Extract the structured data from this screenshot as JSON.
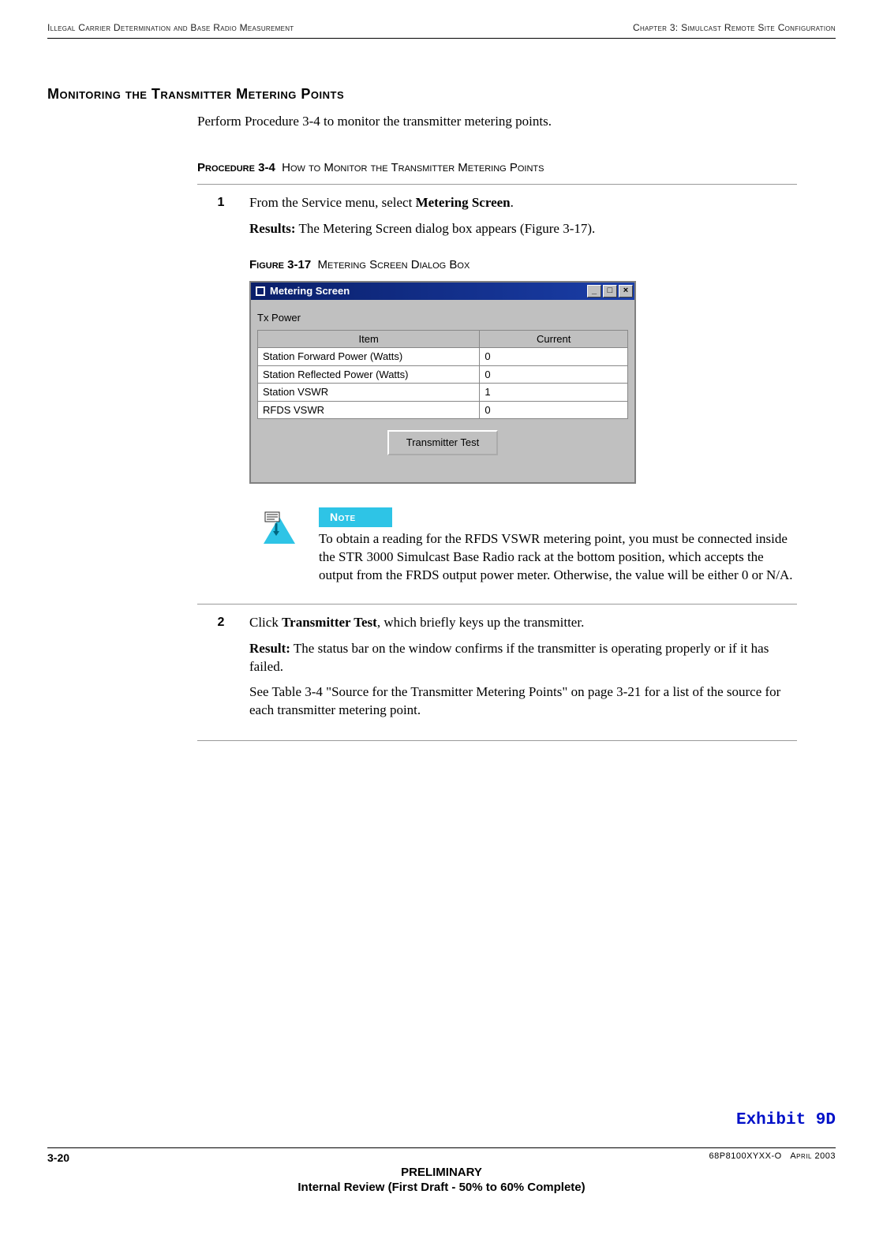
{
  "header": {
    "left": "Illegal Carrier Determination and Base Radio Measurement",
    "right": "Chapter 3: Simulcast Remote Site Configuration"
  },
  "section_heading": "Monitoring the Transmitter Metering Points",
  "intro_paragraph": "Perform Procedure 3-4 to monitor the transmitter metering points.",
  "procedure": {
    "label": "Procedure 3-4",
    "title": "How to Monitor the Transmitter Metering Points",
    "steps": [
      {
        "num": "1",
        "line_prefix": "From the Service menu, select ",
        "line_bold": "Metering Screen",
        "line_suffix": ".",
        "results_label": "Results:",
        "results_text": " The Metering Screen dialog box appears (Figure 3-17)."
      },
      {
        "num": "2",
        "line_prefix": "Click ",
        "line_bold": "Transmitter Test",
        "line_suffix": ", which briefly keys up the transmitter.",
        "results_label": "Result:",
        "results_text": " The status bar on the window confirms if the transmitter is operating properly or if it has failed.",
        "extra": "See Table 3-4 \"Source for the Transmitter Metering Points\" on page 3-21 for a list of the source for each transmitter metering point."
      }
    ]
  },
  "figure": {
    "label": "Figure 3-17",
    "title": "Metering Screen Dialog Box"
  },
  "dialog": {
    "title": "Metering Screen",
    "section_label": "Tx Power",
    "columns": {
      "col1": "Item",
      "col2": "Current"
    },
    "rows": [
      {
        "item": "Station Forward Power (Watts)",
        "current": "0"
      },
      {
        "item": "Station Reflected Power (Watts)",
        "current": "0"
      },
      {
        "item": "Station VSWR",
        "current": "1"
      },
      {
        "item": "RFDS VSWR",
        "current": "0"
      }
    ],
    "button": "Transmitter Test",
    "win_buttons": {
      "min": "_",
      "max": "□",
      "close": "×"
    }
  },
  "note": {
    "badge": "Note",
    "text": "To obtain a reading for the RFDS VSWR metering point, you must be connected inside the STR 3000 Simulcast Base Radio rack at the bottom position, which accepts the output from the FRDS output power meter. Otherwise, the value will be either 0 or N/A."
  },
  "exhibit": "Exhibit 9D",
  "footer": {
    "page": "3-20",
    "docid": "68P8100XYXX-O",
    "date": "April 2003",
    "line1": "PRELIMINARY",
    "line2": "Internal Review (First Draft - 50% to 60% Complete)"
  }
}
